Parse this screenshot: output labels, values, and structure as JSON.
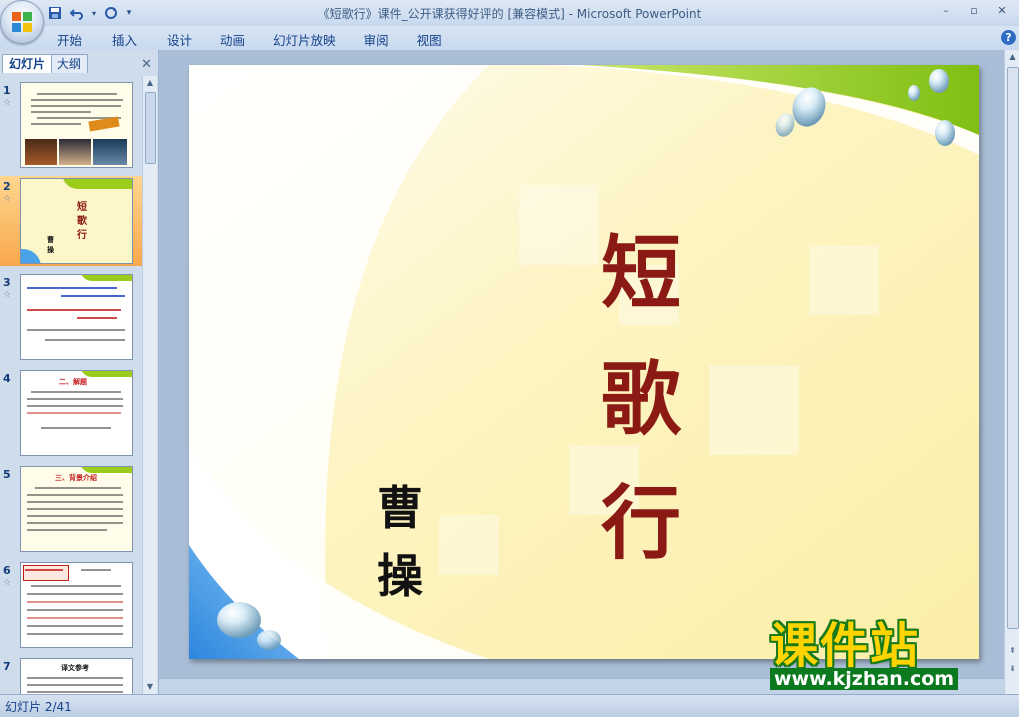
{
  "window": {
    "title": "《短歌行》课件_公开课获得好评的 [兼容模式] - Microsoft PowerPoint",
    "controls": {
      "minimize": "–",
      "restore": "▫",
      "close": "✕"
    }
  },
  "qat": {
    "save_icon": "save-icon",
    "undo_icon": "undo-icon",
    "redo_icon": "redo-icon",
    "customize_icon": "customize-icon"
  },
  "ribbon": {
    "tabs": [
      "开始",
      "插入",
      "设计",
      "动画",
      "幻灯片放映",
      "审阅",
      "视图"
    ],
    "help": "?"
  },
  "panel": {
    "tabs": {
      "slides": "幻灯片",
      "outline": "大纲"
    },
    "close": "✕",
    "thumbnails": [
      {
        "number": "1",
        "star": "☆"
      },
      {
        "number": "2",
        "star": "☆",
        "selected": true,
        "title": "短歌行",
        "author": "曹操"
      },
      {
        "number": "3",
        "star": "☆"
      },
      {
        "number": "4",
        "star": "",
        "title": "二、解题"
      },
      {
        "number": "5",
        "star": "",
        "title": "三、背景介绍"
      },
      {
        "number": "6",
        "star": "☆"
      },
      {
        "number": "7",
        "star": "",
        "title": "译文参考"
      }
    ]
  },
  "slide": {
    "title_chars": [
      "短",
      "歌",
      "行"
    ],
    "author_chars": [
      "曹",
      "操"
    ]
  },
  "status": {
    "slide_counter": "幻灯片 2/41"
  },
  "watermark": {
    "brand": "课件站",
    "url": "www.kjzhan.com"
  },
  "colors": {
    "title_red": "#8b1a14",
    "green_band": "#9ccc1c",
    "blue_corner": "#4aa3e8",
    "cream": "#fdf6c8"
  }
}
